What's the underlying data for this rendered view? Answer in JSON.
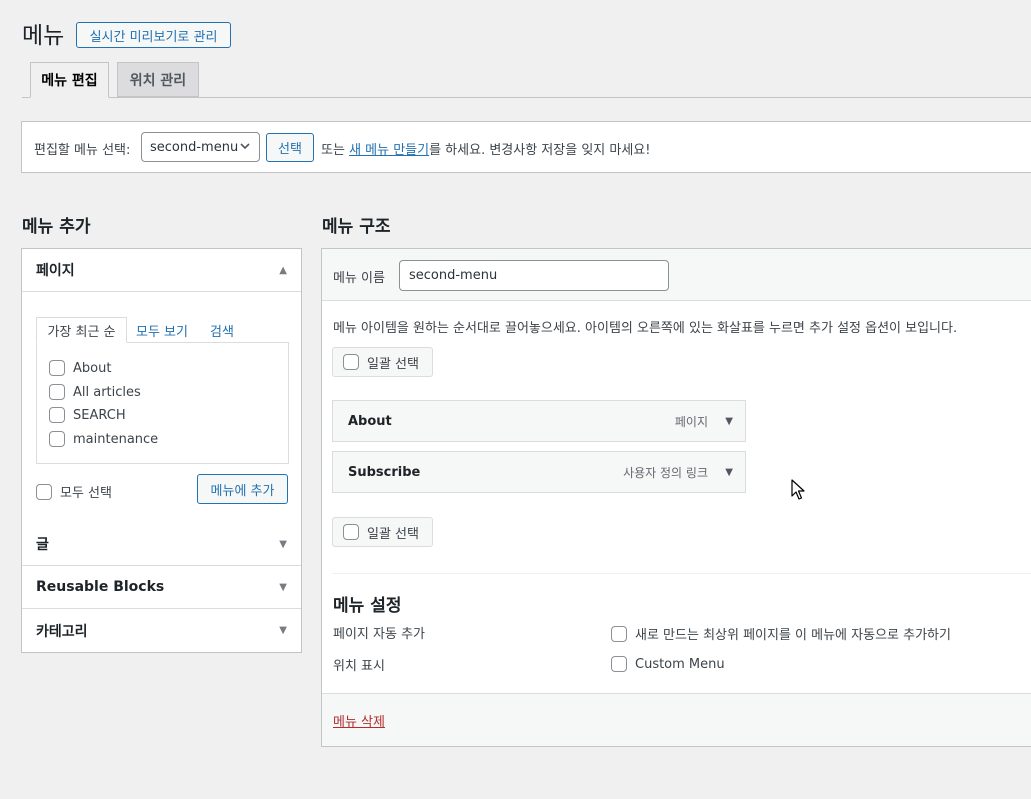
{
  "header": {
    "title": "메뉴",
    "live_preview_button": "실시간 미리보기로 관리"
  },
  "tabs": [
    {
      "label": "메뉴 편집",
      "active": true
    },
    {
      "label": "위치 관리",
      "active": false
    }
  ],
  "select_bar": {
    "label": "편집할 메뉴 선택:",
    "selected_menu": "second-menu",
    "select_button": "선택",
    "text_before_link": "또는",
    "create_link": "새 메뉴 만들기",
    "text_after_link": "를 하세요. 변경사항 저장을 잊지 마세요!"
  },
  "add_menu": {
    "heading": "메뉴 추가",
    "sections": [
      {
        "label": "페이지",
        "expanded": true
      },
      {
        "label": "글",
        "expanded": false
      },
      {
        "label": "Reusable Blocks",
        "expanded": false
      },
      {
        "label": "카테고리",
        "expanded": false
      }
    ],
    "subtabs": [
      "가장 최근 순",
      "모두 보기",
      "검색"
    ],
    "pages": [
      "About",
      "All articles",
      "SEARCH",
      "maintenance"
    ],
    "select_all_label": "모두 선택",
    "add_to_menu_button": "메뉴에 추가"
  },
  "menu_structure": {
    "heading": "메뉴 구조",
    "name_label": "메뉴 이름",
    "name_value": "second-menu",
    "instructions": "메뉴 아이템을 원하는 순서대로 끌어놓으세요. 아이템의 오른쪽에 있는 화살표를 누르면 추가 설정 옵션이 보입니다.",
    "bulk_select_label": "일괄 선택",
    "items": [
      {
        "title": "About",
        "type": "페이지"
      },
      {
        "title": "Subscribe",
        "type": "사용자 정의 링크"
      }
    ],
    "settings": {
      "heading": "메뉴 설정",
      "auto_add_label": "페이지 자동 추가",
      "auto_add_option": "새로 만드는 최상위 페이지를 이 메뉴에 자동으로 추가하기",
      "location_label": "위치 표시",
      "location_option": "Custom Menu"
    },
    "delete_link": "메뉴 삭제"
  },
  "icons": {
    "expanded_arrow": "▲",
    "collapsed_arrow": "▼",
    "select_chevron": "⌄"
  },
  "colors": {
    "accent": "#2271b1",
    "delete": "#b32d2e",
    "background": "#f0f0f1"
  }
}
